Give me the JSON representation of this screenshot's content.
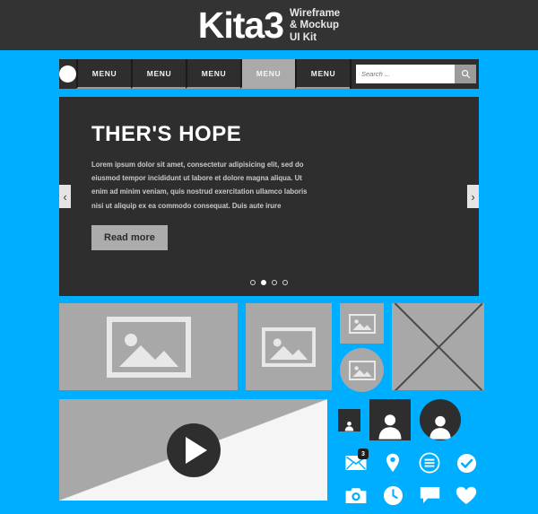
{
  "header": {
    "brand": "Kita3",
    "subtitle_lines": [
      "Wireframe",
      "& Mockup",
      "UI Kit"
    ],
    "bg_color": "#333333"
  },
  "theme": {
    "accent_blue": "#00AEFF",
    "dark_panel": "#2E2E2E",
    "placeholder_gray": "#A8A8A8",
    "active_menu_gray": "#AAAAAA"
  },
  "navbar": {
    "logo_name": "circle-logo",
    "menu_items": [
      {
        "label": "MENU",
        "active": false
      },
      {
        "label": "MENU",
        "active": false
      },
      {
        "label": "MENU",
        "active": false
      },
      {
        "label": "MENU",
        "active": true
      },
      {
        "label": "MENU",
        "active": false
      }
    ],
    "search": {
      "placeholder": "Search ...",
      "value": "",
      "button_icon": "search-icon"
    }
  },
  "hero": {
    "title": "THER'S HOPE",
    "paragraph": "Lorem ipsum dolor sit amet, consectetur adipisicing elit, sed do eiusmod tempor incididunt ut labore et dolore magna aliqua. Ut enim ad minim veniam, quis nostrud exercitation ullamco laboris nisi ut aliquip ex ea commodo consequat. Duis aute irure",
    "cta_label": "Read more",
    "prev_label": "‹",
    "next_label": "›",
    "dots": [
      {
        "active": false
      },
      {
        "active": true
      },
      {
        "active": false
      },
      {
        "active": false
      }
    ]
  },
  "placeholders": [
    {
      "name": "image-placeholder-large",
      "icon": "image-icon"
    },
    {
      "name": "image-placeholder-medium",
      "icon": "image-icon"
    },
    {
      "name": "image-placeholder-small",
      "icon": "image-icon"
    },
    {
      "name": "image-placeholder-circle",
      "icon": "image-icon"
    },
    {
      "name": "image-placeholder-crossed",
      "icon": "x-cross-icon"
    }
  ],
  "video": {
    "play_icon": "play-icon"
  },
  "avatars": [
    {
      "name": "avatar-small-square",
      "shape": "square"
    },
    {
      "name": "avatar-large-square",
      "shape": "square"
    },
    {
      "name": "avatar-circle",
      "shape": "circle"
    }
  ],
  "icon_grid": [
    {
      "name": "envelope-icon",
      "badge": "3"
    },
    {
      "name": "location-pin-icon",
      "badge": ""
    },
    {
      "name": "menu-circle-icon",
      "badge": ""
    },
    {
      "name": "check-circle-icon",
      "badge": ""
    },
    {
      "name": "camera-icon",
      "badge": ""
    },
    {
      "name": "clock-icon",
      "badge": ""
    },
    {
      "name": "chat-bubble-icon",
      "badge": ""
    },
    {
      "name": "heart-icon",
      "badge": ""
    }
  ]
}
